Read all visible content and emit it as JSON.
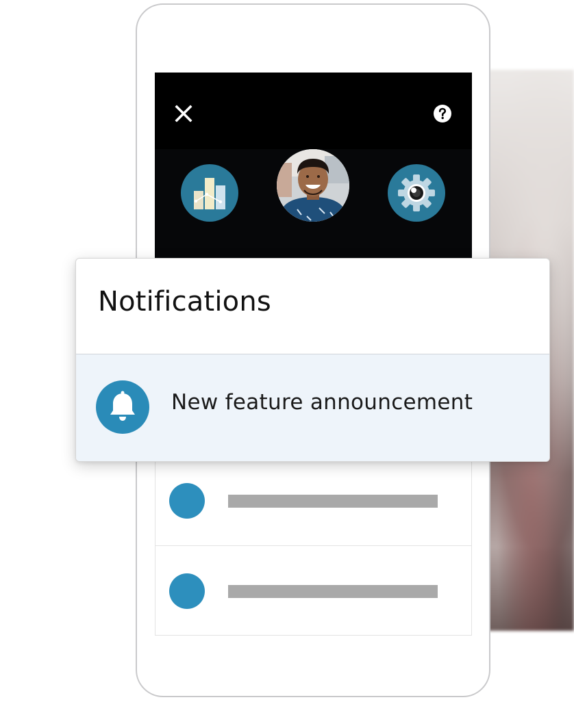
{
  "notifications_card": {
    "title": "Notifications",
    "items": [
      {
        "label": "New feature announcement",
        "icon": "bell-icon"
      }
    ]
  },
  "header": {
    "icons": [
      "close-icon",
      "help-icon",
      "bar-chart-icon",
      "avatar",
      "gear-icon"
    ]
  },
  "colors": {
    "accent": "#2a8bb8",
    "header_bg": "#060709",
    "highlight_row": "#eef4fa",
    "placeholder_bar": "#a9a9a9"
  }
}
